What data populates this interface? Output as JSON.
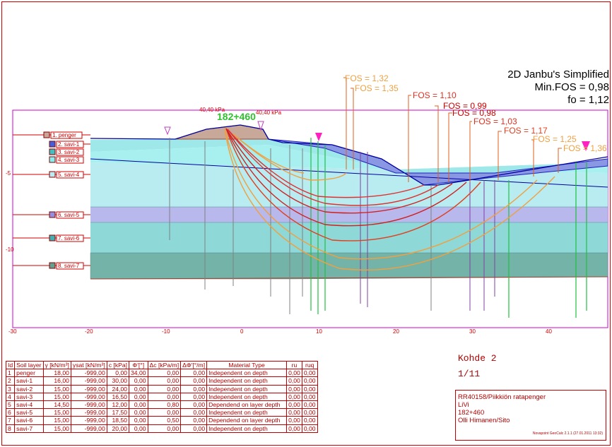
{
  "header": {
    "method": "2D Janbu's Simplified",
    "min_fos": "Min.FOS = 0,98",
    "fo": "fo = 1,12"
  },
  "profile": {
    "station_big": "182+460",
    "load_left": "40,40 kPa",
    "load_right": "40,40 kPa",
    "fos_labels": [
      "FOS = 1,32",
      "FOS = 1,35",
      "FOS = 1,10",
      "FOS = 0,99",
      "FOS = 0,98",
      "FOS = 1,03",
      "FOS = 1,17",
      "FOS = 1,25",
      "FOS = 1,36"
    ],
    "layer_tags": [
      "1. penger",
      "2. savi-1",
      "3. savi-2",
      "4. savi-3",
      "5. savi-4",
      "6. savi-5",
      "7. savi-6",
      "8. savi-7"
    ],
    "x_ticks": [
      "-30",
      "-20",
      "-10",
      "0",
      "10",
      "20",
      "30",
      "40"
    ],
    "y_ticks": [
      "-5",
      "-10"
    ],
    "colors": {
      "penger": "#c8a898",
      "savi1": "#8898e8",
      "savi2": "#9ee8ea",
      "savi3": "#a8f0f0",
      "savi4": "#b8ecf0",
      "savi5": "#b8b8ec",
      "savi6": "#8ed8d8",
      "savi7": "#74b4a8",
      "frame": "#d00000"
    }
  },
  "table": {
    "headers": [
      "Id",
      "Soil layer",
      "γ [kN/m³]",
      "γsat [kN/m³]",
      "c [kPa]",
      "Φ'[°]",
      "Δc [kPa/m]",
      "ΔΦ'[°/m]",
      "Material Type",
      "ru",
      "ruq"
    ],
    "rows": [
      [
        "1",
        "penger",
        "18,00",
        "-999,00",
        "0,00",
        "34,00",
        "0,00",
        "0,00",
        "Independent on depth",
        "0,00",
        "0,00"
      ],
      [
        "2",
        "savi-1",
        "16,00",
        "-999,00",
        "30,00",
        "0,00",
        "0,00",
        "0,00",
        "Independent on depth",
        "0,00",
        "0,00"
      ],
      [
        "3",
        "savi-2",
        "15,00",
        "-999,00",
        "24,00",
        "0,00",
        "0,00",
        "0,00",
        "Independent on depth",
        "0,00",
        "0,00"
      ],
      [
        "4",
        "savi-3",
        "15,00",
        "-999,00",
        "16,50",
        "0,00",
        "0,00",
        "0,00",
        "Independent on depth",
        "0,00",
        "0,00"
      ],
      [
        "5",
        "savi-4",
        "14,50",
        "-999,00",
        "12,00",
        "0,00",
        "0,80",
        "0,00",
        "Dependend on layer depth",
        "0,00",
        "0,00"
      ],
      [
        "6",
        "savi-5",
        "15,00",
        "-999,00",
        "17,50",
        "0,00",
        "0,00",
        "0,00",
        "Independent on depth",
        "0,00",
        "0,00"
      ],
      [
        "7",
        "savi-6",
        "15,00",
        "-999,00",
        "18,50",
        "0,00",
        "0,50",
        "0,00",
        "Dependend on layer depth",
        "0,00",
        "0,00"
      ],
      [
        "8",
        "savi-7",
        "15,00",
        "-999,00",
        "20,00",
        "0,00",
        "0,00",
        "0,00",
        "Independent on depth",
        "0,00",
        "0,00"
      ]
    ]
  },
  "kohde": {
    "line1": "Kohde 2",
    "line2": "1/11"
  },
  "info": {
    "line1": "RR40158/Piikkiön ratapenger",
    "line2": "LiVi",
    "line3": "182+460",
    "line4": "Olli Himanen/Sito",
    "software": "Novapoint GeoCalc 2.1.1     (27.01.2011 13:32)"
  }
}
